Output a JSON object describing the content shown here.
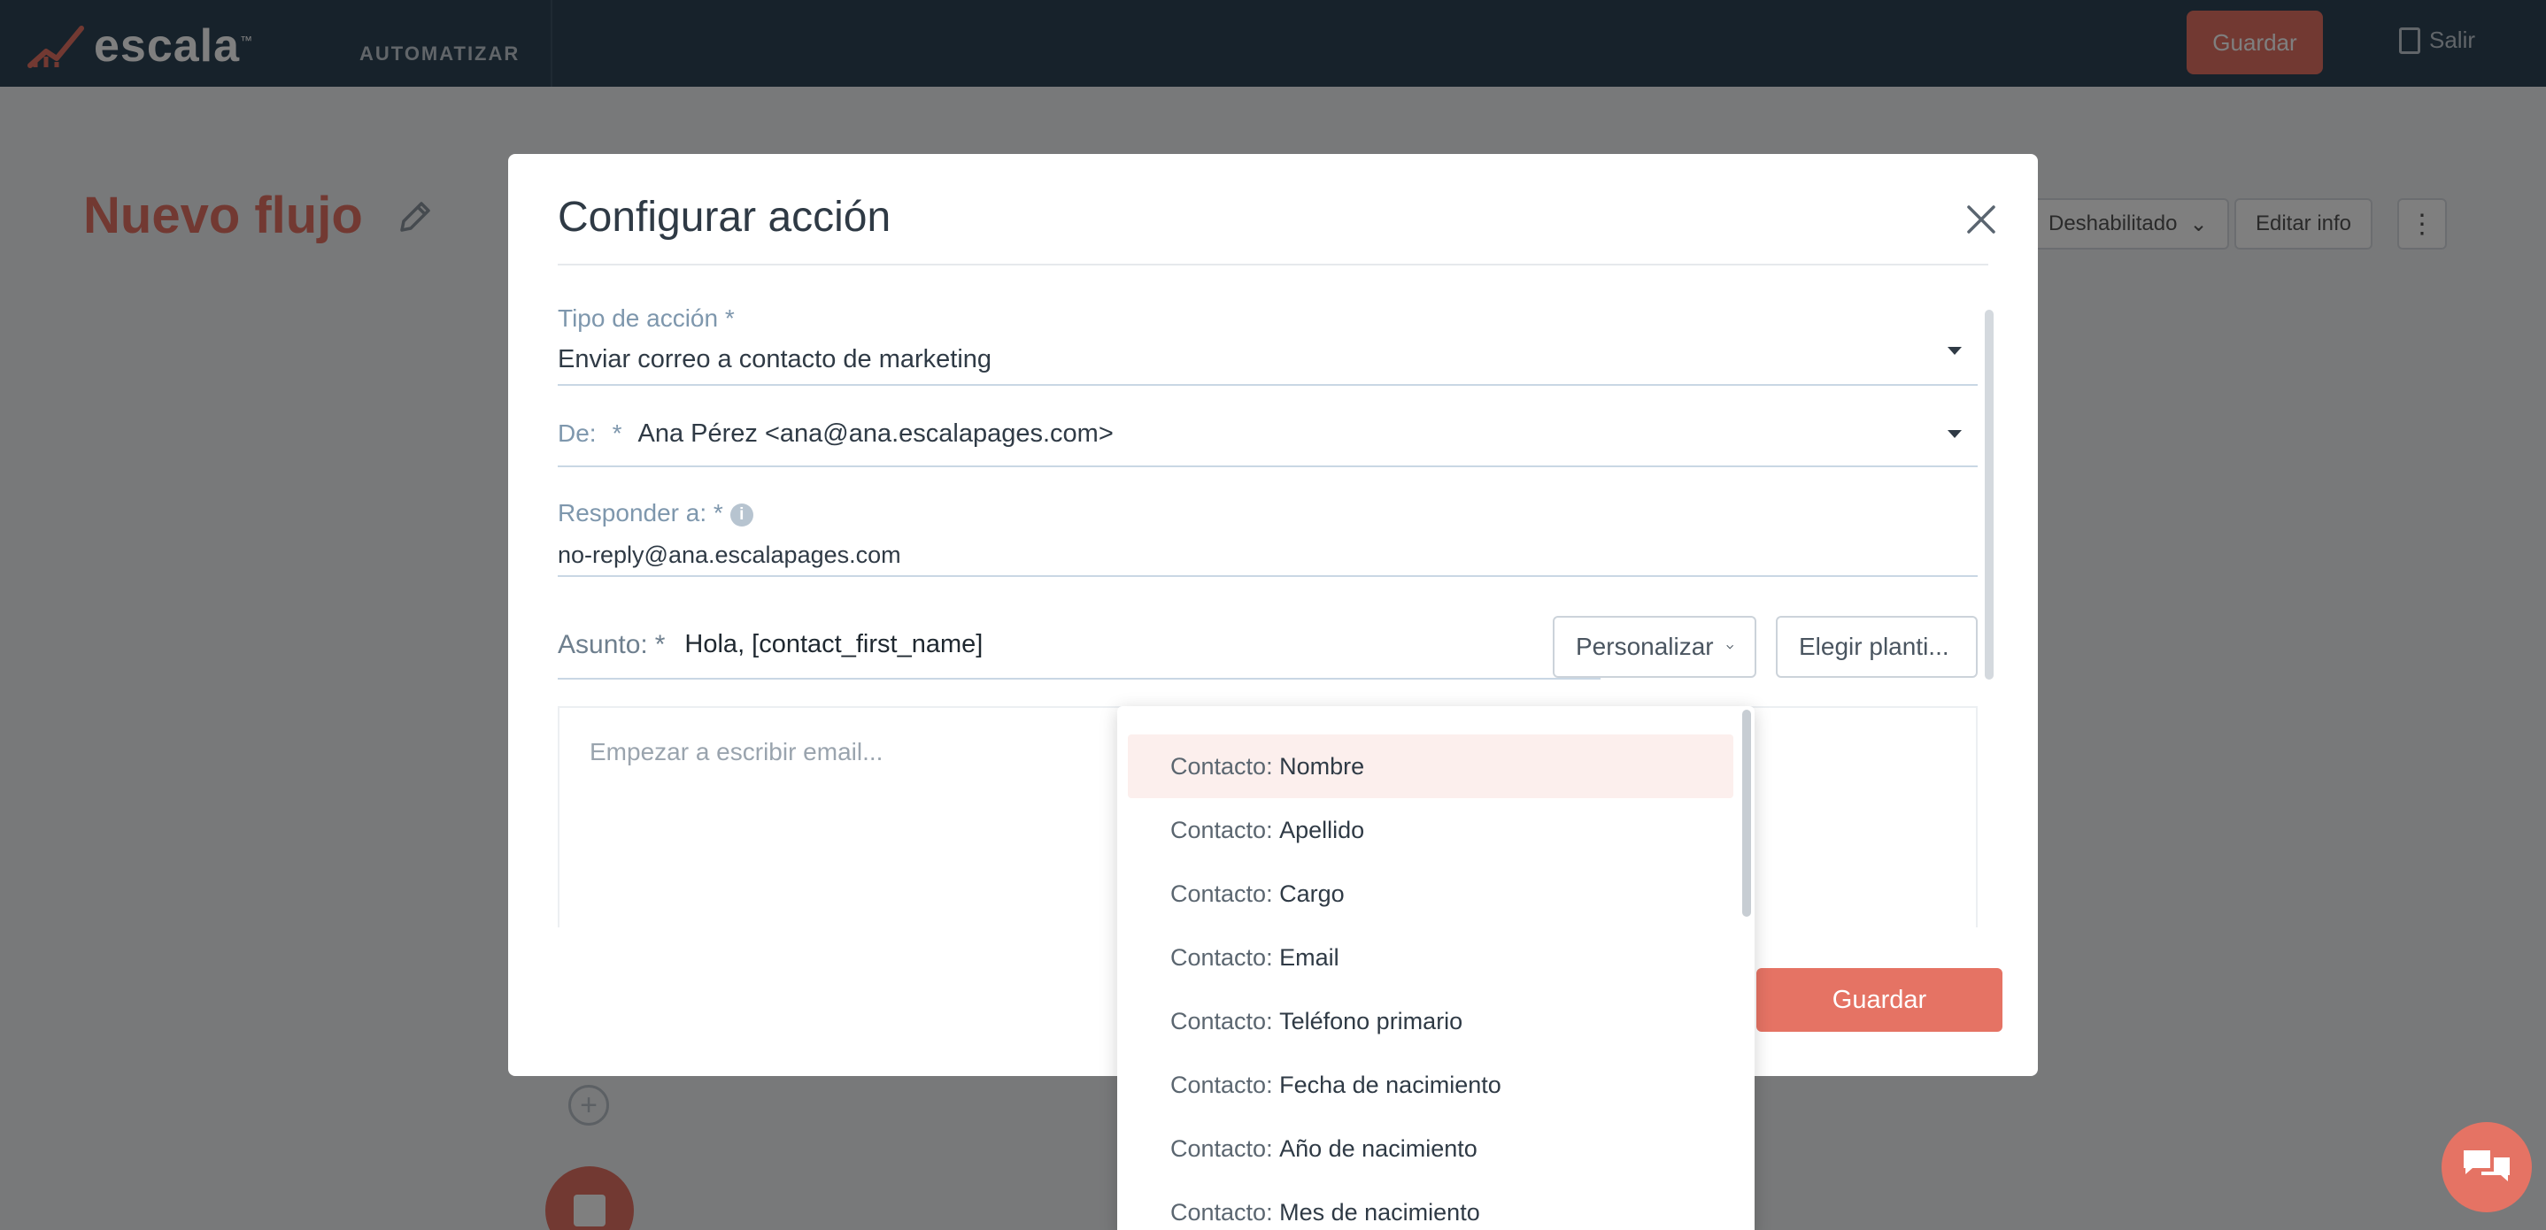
{
  "app": {
    "logo_text": "escala",
    "logo_mark": "™",
    "nav_label": "AUTOMATIZAR",
    "save_label": "Guardar",
    "exit_label": "Salir"
  },
  "page": {
    "title": "Nuevo flujo",
    "status_label": "Deshabilitado",
    "edit_info_label": "Editar info"
  },
  "modal": {
    "title": "Configurar acción",
    "action_type": {
      "label": "Tipo de acción *",
      "value": "Enviar correo a contacto de marketing"
    },
    "from": {
      "label": "De:",
      "required": "*",
      "value": "Ana Pérez <ana@ana.escalapages.com>"
    },
    "reply_to": {
      "label": "Responder a: *",
      "value": "no-reply@ana.escalapages.com"
    },
    "subject": {
      "label": "Asunto:",
      "required": "*",
      "value": "Hola, [contact_first_name]"
    },
    "personalize_label": "Personalizar",
    "template_label": "Elegir planti...",
    "editor_placeholder": "Empezar a escribir email...",
    "save_label": "Guardar"
  },
  "dropdown": {
    "items": [
      {
        "prefix": "Contacto:",
        "field": "Nombre"
      },
      {
        "prefix": "Contacto:",
        "field": "Apellido"
      },
      {
        "prefix": "Contacto:",
        "field": "Cargo"
      },
      {
        "prefix": "Contacto:",
        "field": "Email"
      },
      {
        "prefix": "Contacto:",
        "field": "Teléfono primario"
      },
      {
        "prefix": "Contacto:",
        "field": "Fecha de nacimiento"
      },
      {
        "prefix": "Contacto:",
        "field": "Año de nacimiento"
      },
      {
        "prefix": "Contacto:",
        "field": "Mes de nacimiento"
      }
    ]
  },
  "colors": {
    "accent": "#e57364",
    "topbar": "#2e4556",
    "label": "#7e97ad",
    "highlight": "#fcefed"
  }
}
